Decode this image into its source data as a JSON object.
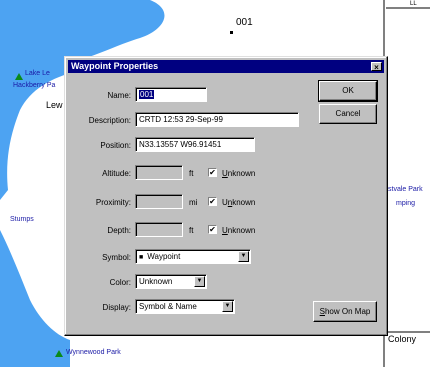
{
  "map": {
    "waypoint_label": "001",
    "labels": {
      "lake": "Lake Le",
      "hackberry": "Hackberry Pa",
      "lew": "Lew",
      "stumps": "Stumps",
      "estvale": "stvale Park",
      "mping": "mping",
      "wynnewood": "Wynnewood Park",
      "colony": "Colony",
      "corner": "LL"
    }
  },
  "dialog": {
    "title": "Waypoint Properties",
    "close_glyph": "×",
    "name_label": "Name:",
    "name_value": "001",
    "description_label": "Description:",
    "description_value": "CRTD 12:53 29-Sep-99",
    "position_label": "Position:",
    "position_value": "N33.13557 W96.91451",
    "altitude_label": "Altitude:",
    "altitude_unit": "ft",
    "proximity_label": "Proximity:",
    "proximity_unit": "mi",
    "depth_label": "Depth:",
    "depth_unit": "ft",
    "unknown_prefix": "U",
    "unknown_rest": "nknown",
    "symbol_label": "Symbol:",
    "symbol_glyph": "■",
    "symbol_value": "Waypoint",
    "color_label": "Color:",
    "color_value": "Unknown",
    "display_label": "Display:",
    "display_value": "Symbol & Name",
    "ok_label": "OK",
    "cancel_label": "Cancel",
    "show_on_map_prefix": "S",
    "show_on_map_rest": "how On Map",
    "check_glyph": "✔",
    "arrow_glyph": "▼"
  },
  "colors": {
    "titlebar": "#000080",
    "dialog_bg": "#c0c0c0",
    "water": "#4da3f2",
    "map_label": "#1a1aa6"
  }
}
